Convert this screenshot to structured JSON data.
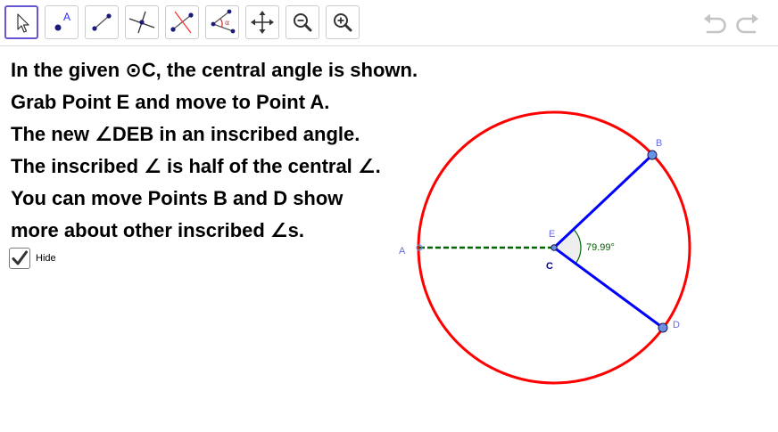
{
  "toolbar": {
    "tools": [
      {
        "name": "move-tool",
        "icon": "arrow-pointer-icon",
        "active": true
      },
      {
        "name": "point-tool",
        "icon": "point-icon",
        "label": "A",
        "active": false
      },
      {
        "name": "segment-tool",
        "icon": "segment-icon",
        "active": false
      },
      {
        "name": "perpendicular-line-tool",
        "icon": "perpendicular-line-icon",
        "active": false
      },
      {
        "name": "perpendicular-bisector-tool",
        "icon": "perpendicular-bisector-icon",
        "active": false
      },
      {
        "name": "angle-tool",
        "icon": "angle-icon",
        "label": "α",
        "active": false
      },
      {
        "name": "move-graphics-view-tool",
        "icon": "move-arrows-icon",
        "active": false
      },
      {
        "name": "zoom-out-tool",
        "icon": "zoom-out-icon",
        "active": false
      },
      {
        "name": "zoom-in-tool",
        "icon": "zoom-in-icon",
        "active": false
      }
    ],
    "undo_icon": "undo-icon",
    "redo_icon": "redo-icon"
  },
  "instructions": [
    "In the given ⊙C, the central angle is shown.",
    "Grab Point E and move to Point A.",
    "The new ∠DEB in an inscribed angle.",
    "The inscribed ∠ is half of the central ∠.",
    "You can move Points B and D show",
    "more about other inscribed ∠s."
  ],
  "hide_checkbox": {
    "label": "Hide",
    "checked": true
  },
  "graphics": {
    "points": {
      "A": "A",
      "B": "B",
      "C": "C",
      "D": "D",
      "E": "E"
    },
    "angle_label": "79.99°",
    "colors": {
      "circle": "#ff0000",
      "segments": "#0000ff",
      "dashed": "#006400",
      "angle_text": "#006400",
      "point_fill": "#6a8fe6",
      "point_label": "#6a6ae6",
      "center_label": "#00008b",
      "active_tool": "#6557d2"
    }
  }
}
